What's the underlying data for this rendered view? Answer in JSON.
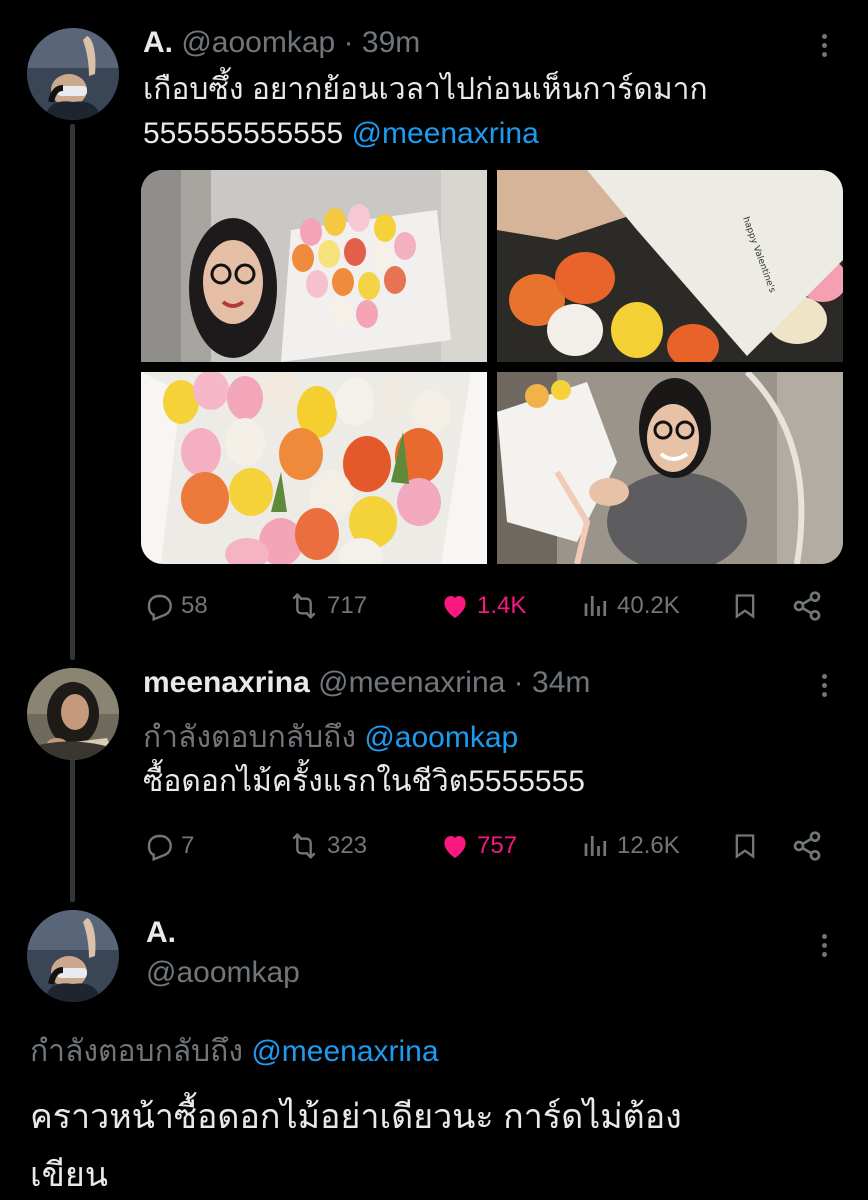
{
  "tweet1": {
    "display_name": "A.",
    "handle": "@aoomkap",
    "separator": "·",
    "time": "39m",
    "text_line1": "เกือบซึ้ง อยากย้อนเวลาไปก่อนเห็นการ์ดมาก",
    "text_line2": "555555555555",
    "mention": "@meenaxrina",
    "replies": "58",
    "retweets": "717",
    "likes": "1.4K",
    "views": "40.2K",
    "liked": true
  },
  "tweet2": {
    "display_name": "meenaxrina",
    "handle": "@meenaxrina",
    "separator": "·",
    "time": "34m",
    "replying_prefix": "กำลังตอบกลับถึง",
    "replying_to": "@aoomkap",
    "text": "ซื้อดอกไม้ครั้งแรกในชีวิต5555555",
    "replies": "7",
    "retweets": "323",
    "likes": "757",
    "views": "12.6K",
    "liked": true
  },
  "tweet3": {
    "display_name": "A.",
    "handle": "@aoomkap",
    "replying_prefix": "กำลังตอบกลับถึง",
    "replying_to": "@meenaxrina",
    "text_line1": "คราวหน้าซื้อดอกไม้อย่าเดียวนะ การ์ดไม่ต้อง",
    "text_line2": "เขียน"
  },
  "colors": {
    "background": "#000000",
    "text": "#e7e9ea",
    "muted": "#71767b",
    "link": "#1d9bf0",
    "like": "#f91880",
    "thread_line": "#333639"
  },
  "icons": {
    "reply": "reply-icon",
    "retweet": "retweet-icon",
    "like": "heart-icon",
    "views": "views-icon",
    "bookmark": "bookmark-icon",
    "share": "share-icon",
    "more": "more-icon"
  }
}
